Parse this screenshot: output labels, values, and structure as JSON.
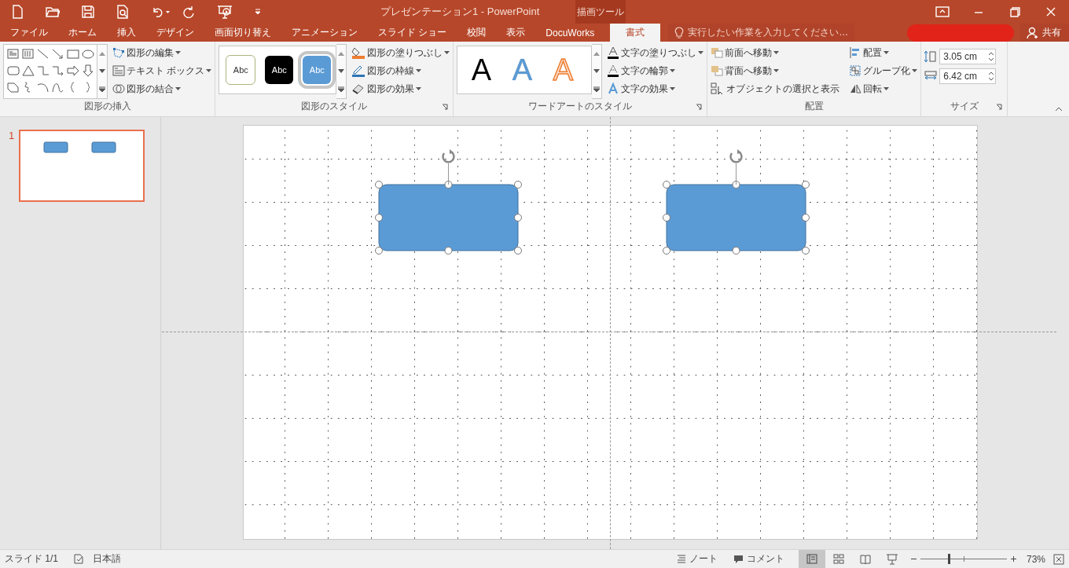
{
  "window": {
    "title": "プレゼンテーション1 - PowerPoint",
    "contextual_group": "描画ツール",
    "share": "共有",
    "tell_me": {
      "placeholder": "実行したい作業を入力してください…"
    }
  },
  "tabs": [
    {
      "label": "ファイル",
      "selected": false
    },
    {
      "label": "ホーム",
      "selected": false
    },
    {
      "label": "挿入",
      "selected": false
    },
    {
      "label": "デザイン",
      "selected": false
    },
    {
      "label": "画面切り替え",
      "selected": false
    },
    {
      "label": "アニメーション",
      "selected": false
    },
    {
      "label": "スライド ショー",
      "selected": false
    },
    {
      "label": "校閲",
      "selected": false
    },
    {
      "label": "表示",
      "selected": false
    },
    {
      "label": "DocuWorks",
      "selected": false
    },
    {
      "label": "書式",
      "selected": true
    }
  ],
  "ribbon": {
    "insert_shapes": {
      "label": "図形の挿入",
      "buttons": [
        "図形の編集",
        "テキスト ボックス",
        "図形の結合"
      ]
    },
    "shape_styles": {
      "label": "図形のスタイル",
      "gallery": [
        {
          "label": "Abc",
          "kind": "outline",
          "selected": false
        },
        {
          "label": "Abc",
          "kind": "dark",
          "selected": false
        },
        {
          "label": "Abc",
          "kind": "accent",
          "selected": true
        }
      ],
      "buttons": [
        "図形の塗りつぶし",
        "図形の枠線",
        "図形の効果"
      ]
    },
    "wordart_styles": {
      "label": "ワードアートのスタイル",
      "gallery": [
        {
          "label": "A",
          "kind": "plain"
        },
        {
          "label": "A",
          "kind": "accent"
        },
        {
          "label": "A",
          "kind": "outline"
        }
      ],
      "buttons": [
        "文字の塗りつぶし",
        "文字の輪郭",
        "文字の効果"
      ]
    },
    "arrange": {
      "label": "配置",
      "buttons": [
        "前面へ移動",
        "背面へ移動",
        "オブジェクトの選択と表示",
        "配置",
        "グループ化",
        "回転"
      ]
    },
    "size": {
      "label": "サイズ",
      "height": "3.05 cm",
      "width": "6.42 cm"
    }
  },
  "slides_pane": [
    {
      "number": "1",
      "selected": true
    }
  ],
  "slide": {
    "shapes": [
      {
        "selected": true
      },
      {
        "selected": true
      }
    ]
  },
  "status_bar": {
    "slide": "スライド 1/1",
    "language": "日本語",
    "notes": "ノート",
    "comments": "コメント",
    "views": [
      {
        "selected": true
      },
      {
        "selected": false
      },
      {
        "selected": false
      },
      {
        "selected": false
      }
    ],
    "zoom": {
      "level": 0.33,
      "reading": "73%"
    }
  }
}
